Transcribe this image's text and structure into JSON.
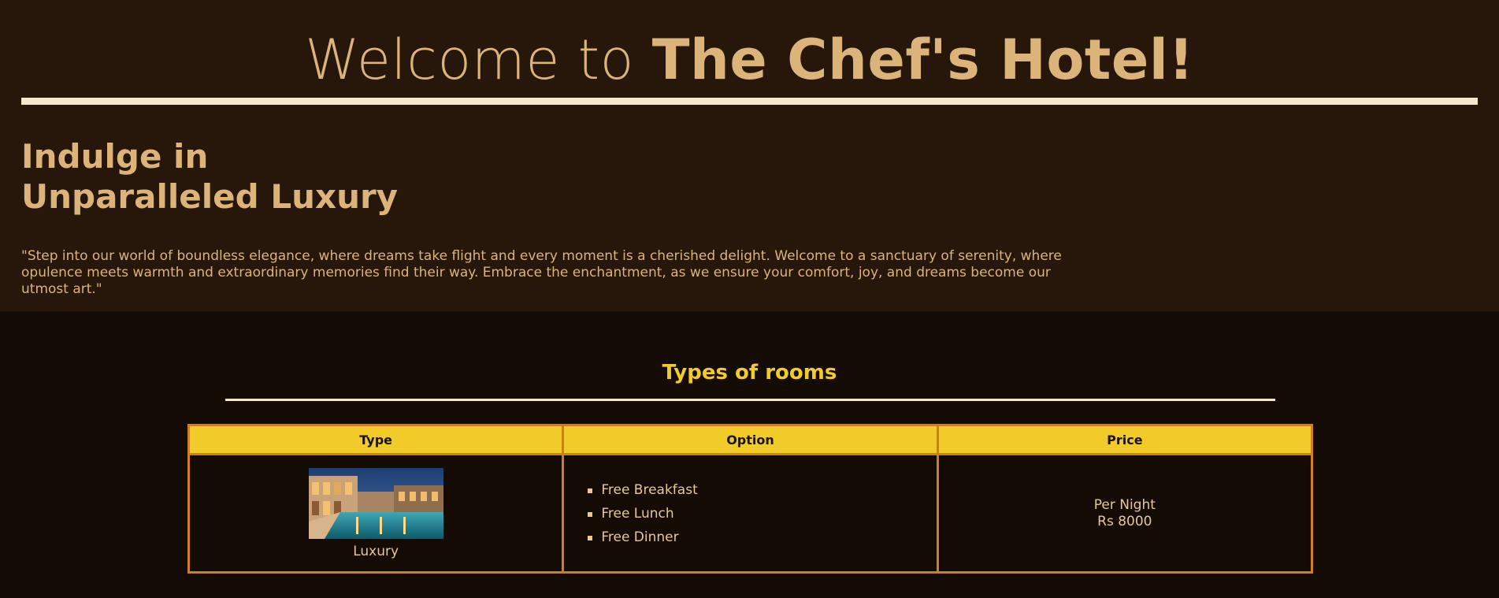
{
  "hero": {
    "welcome_prefix": "Welcome to ",
    "hotel_name": "The Chef's Hotel!",
    "heading_line1": "Indulge in",
    "heading_line2": "Unparalleled Luxury",
    "tagline": "\"Step into our world of boundless elegance, where dreams take flight and every moment is a cherished delight. Welcome to a sanctuary of serenity, where opulence meets warmth and extraordinary memories find their way. Embrace the enchantment, as we ensure your comfort, joy, and dreams become our utmost art.\""
  },
  "rooms": {
    "title": "Types of rooms",
    "table": {
      "headers": [
        "Type",
        "Option",
        "Price"
      ],
      "rows": [
        {
          "type": "Luxury",
          "image_icon": "hotel-pool-photo",
          "options": [
            "Free Breakfast",
            "Free Lunch",
            "Free Dinner"
          ],
          "price_label": "Per Night",
          "price_value": "Rs 8000"
        }
      ]
    }
  },
  "colors": {
    "hero_background": "#26170a",
    "page_background": "#130b04",
    "accent_gold": "#dcb47a",
    "accent_yellow": "#f0cb2a",
    "table_border": "#cc7f22"
  }
}
